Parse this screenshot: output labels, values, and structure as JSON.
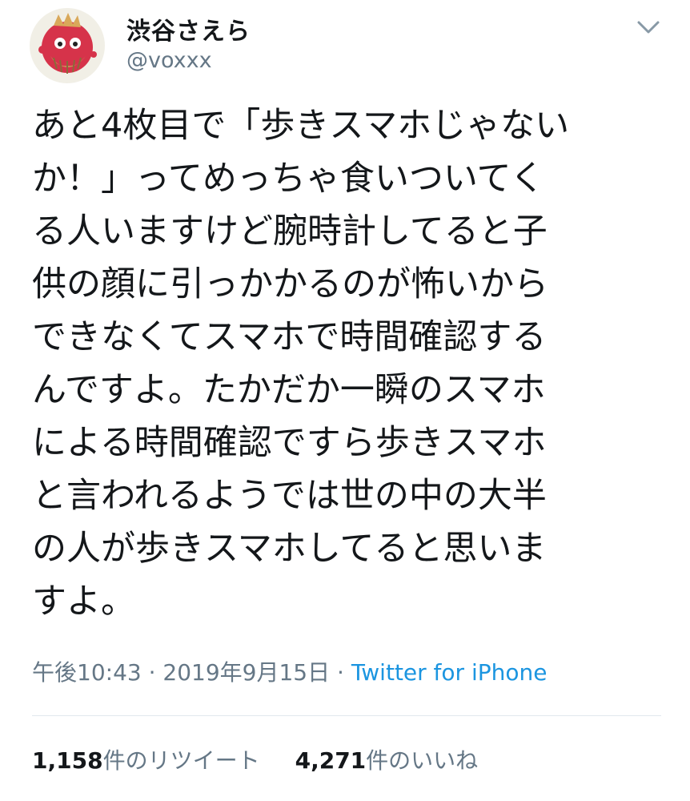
{
  "author": {
    "display_name": "渋谷さえら",
    "handle": "@voxxx",
    "avatar_icon": "character-avatar-icon",
    "menu_icon": "chevron-down-icon"
  },
  "tweet": {
    "lines": [
      "あと4枚目で「歩きスマホじゃない",
      "か！」ってめっちゃ食いついてく",
      "る人いますけど腕時計してると子",
      "供の顔に引っかかるのが怖いから",
      "できなくてスマホで時間確認する",
      "んですよ。たかだか一瞬のスマホ",
      "による時間確認ですら歩きスマホ",
      "と言われるようでは世の中の大半",
      "の人が歩きスマホしてると思いま",
      "すよ。"
    ]
  },
  "meta": {
    "time": "午後10:43",
    "separator": " · ",
    "date": "2019年9月15日",
    "source": "Twitter for iPhone"
  },
  "stats": {
    "retweets_count": "1,158",
    "retweets_label": "件のリツイート",
    "likes_count": "4,271",
    "likes_label": "件のいいね"
  },
  "colors": {
    "text": "#14171a",
    "secondary": "#657786",
    "link": "#1b95e0",
    "divider": "#e1e8ed"
  }
}
